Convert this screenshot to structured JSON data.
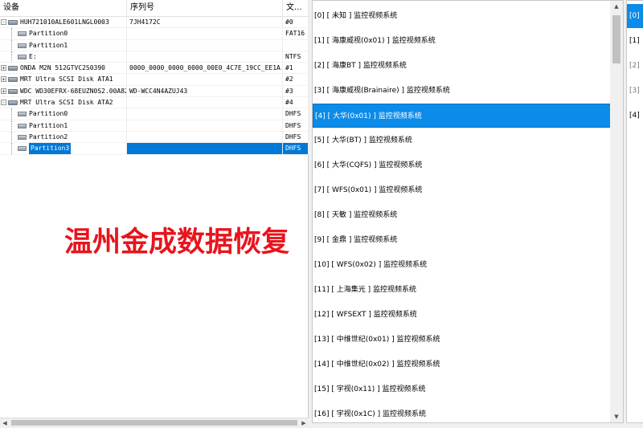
{
  "device_table": {
    "columns": [
      "设备",
      "序列号",
      "文..."
    ],
    "rows": [
      {
        "name": "HGST HUH721010ALE601LNGL0003",
        "display": "HUH721010ALE601LNGL0003",
        "serial": "7JH4172C",
        "info": "#0",
        "level": 0,
        "expander": "-",
        "icon": "disk-icon"
      },
      {
        "name": "Partition0",
        "serial": "",
        "info": "FAT16",
        "level": 1,
        "icon": "partition-icon"
      },
      {
        "name": "Partition1",
        "serial": "",
        "info": "",
        "level": 1,
        "icon": "partition-icon"
      },
      {
        "name": "E:",
        "serial": "",
        "info": "NTFS",
        "level": 1,
        "icon": "partition-icon"
      },
      {
        "name": "ONDA M2N 512GTVC2S0390",
        "serial": "0000_0000_0000_0000_00E0_4C7E_19CC_EE1A.",
        "info": "#1",
        "level": 0,
        "expander": "+",
        "icon": "disk-icon"
      },
      {
        "name": "MRT Ultra SCSI Disk ATA1",
        "serial": "",
        "info": "#2",
        "level": 0,
        "expander": "+",
        "icon": "disk-icon"
      },
      {
        "name": "WDC WD30EFRX-68EUZN0S2.00A82",
        "serial": "WD-WCC4N4AZUJ43",
        "info": "#3",
        "level": 0,
        "expander": "+",
        "icon": "disk-icon"
      },
      {
        "name": "MRT Ultra SCSI Disk ATA2",
        "serial": "",
        "info": "#4",
        "level": 0,
        "expander": "-",
        "icon": "disk-icon"
      },
      {
        "name": "Partition0",
        "serial": "",
        "info": "DHFS",
        "level": 1,
        "icon": "partition-icon"
      },
      {
        "name": "Partition1",
        "serial": "",
        "info": "DHFS",
        "level": 1,
        "icon": "partition-icon"
      },
      {
        "name": "Partition2",
        "serial": "",
        "info": "DHFS",
        "level": 1,
        "icon": "partition-icon"
      },
      {
        "name": "Partition3",
        "serial": "",
        "info": "DHFS",
        "level": 1,
        "icon": "partition-icon",
        "selected": true
      }
    ]
  },
  "watermark": "温州金成数据恢复",
  "system_list": [
    {
      "label": "[0]  [ 未知 ] 监控视频系统"
    },
    {
      "label": "[1]  [ 海康威视(0x01) ] 监控视频系统"
    },
    {
      "label": "[2]  [ 海康BT ] 监控视频系统"
    },
    {
      "label": "[3]  [ 海康威视(Brainaire) ] 监控视频系统"
    },
    {
      "label": "[4]  [ 大华(0x01) ] 监控视频系统",
      "selected": true
    },
    {
      "label": "[5]  [ 大华(BT) ] 监控视频系统"
    },
    {
      "label": "[6]  [ 大华(CQFS) ] 监控视频系统"
    },
    {
      "label": "[7]  [ WFS(0x01) ] 监控视频系统"
    },
    {
      "label": "[8]  [ 天敏 ] 监控视频系统"
    },
    {
      "label": "[9]  [ 金鼎 ] 监控视频系统"
    },
    {
      "label": "[10]  [ WFS(0x02) ] 监控视频系统"
    },
    {
      "label": "[11]  [ 上海集光 ] 监控视频系统"
    },
    {
      "label": "[12]  [ WFSEXT ] 监控视频系统"
    },
    {
      "label": "[13]  [ 中维世纪(0x01) ] 监控视频系统"
    },
    {
      "label": "[14]  [ 中维世纪(0x02) ] 监控视频系统"
    },
    {
      "label": "[15]  [ 宇视(0x11) ] 监控视频系统"
    },
    {
      "label": "[16]  [ 宇视(0x1C) ] 监控视频系统"
    }
  ],
  "right_list": [
    {
      "label": "[0]",
      "selected": true
    },
    {
      "label": "[1]"
    },
    {
      "label": "[2]",
      "dim": true
    },
    {
      "label": "[3]",
      "dim": true
    },
    {
      "label": "[4]"
    }
  ],
  "colors": {
    "selection": "#0078d7",
    "list_selection": "#0c8ce9",
    "watermark": "#e8141c"
  }
}
